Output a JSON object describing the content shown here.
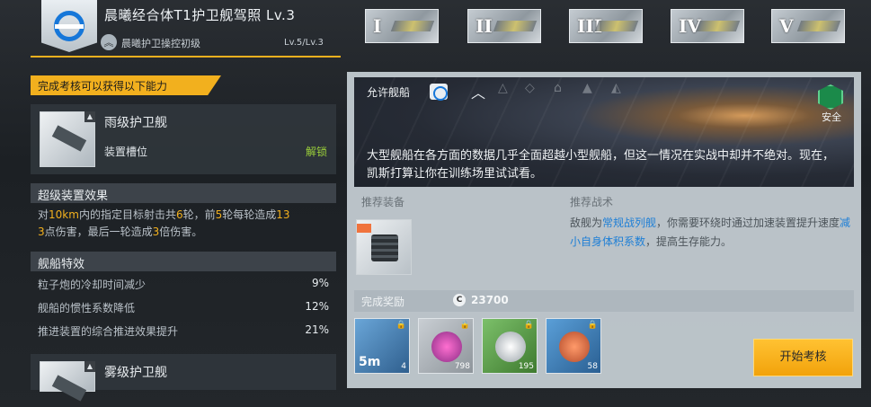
{
  "header": {
    "title": "晨曦经合体T1护卫舰驾照 Lv.3",
    "subtitle": "晨曦护卫操控初级",
    "level": "Lv.5/Lv.3",
    "tiers": [
      "I",
      "II",
      "III",
      "IV",
      "V"
    ]
  },
  "left": {
    "requirement_banner": "完成考核可以获得以下能力",
    "ship1": {
      "name": "雨级护卫舰",
      "slot_label": "装置槽位",
      "unlock_label": "解锁"
    },
    "super_title": "超级装置效果",
    "super_desc": {
      "p1": "对",
      "p2": "10km",
      "p3": "内的指定目标射击共",
      "p4": "6",
      "p5": "轮，前",
      "p6": "5",
      "p7": "轮每轮造成",
      "p8": "13",
      "p9": "3",
      "p10": "点伤害，最后一轮造成",
      "p11": "3",
      "p12": "倍伤害。"
    },
    "traits_title": "舰船特效",
    "traits": [
      {
        "name": "粒子炮的冷却时间减少",
        "value": "9%"
      },
      {
        "name": "舰船的惯性系数降低",
        "value": "12%"
      },
      {
        "name": "推进装置的综合推进效果提升",
        "value": "21%"
      }
    ],
    "ship2": {
      "name": "雾级护卫舰"
    }
  },
  "right": {
    "allowed_label": "允许舰船",
    "safe_label": "安全",
    "description": "大型舰船在各方面的数据几乎全面超越小型舰船，但这一情况在实战中却并不绝对。现在，凯斯打算让你在训练场里试试看。",
    "equip_label": "推荐装备",
    "tactic_label": "推荐战术",
    "tactic": {
      "t1": "敌舰为",
      "t2": "常规战列舰",
      "t3": "，你需要环绕时通过加速装置提升速度",
      "t4": "减小自身体积系数",
      "t5": "，提高生存能力。"
    },
    "reward_label": "完成奖励",
    "coin_symbol": "C",
    "coin_value": "23700",
    "items": [
      {
        "count": "4",
        "duration": "5m"
      },
      {
        "count": "798"
      },
      {
        "count": "195"
      },
      {
        "count": "58"
      }
    ],
    "start_button": "开始考核"
  },
  "colors": {
    "accent": "#f2b01e",
    "highlight_blue": "#1e7fd6",
    "button": "#f2a20b"
  }
}
